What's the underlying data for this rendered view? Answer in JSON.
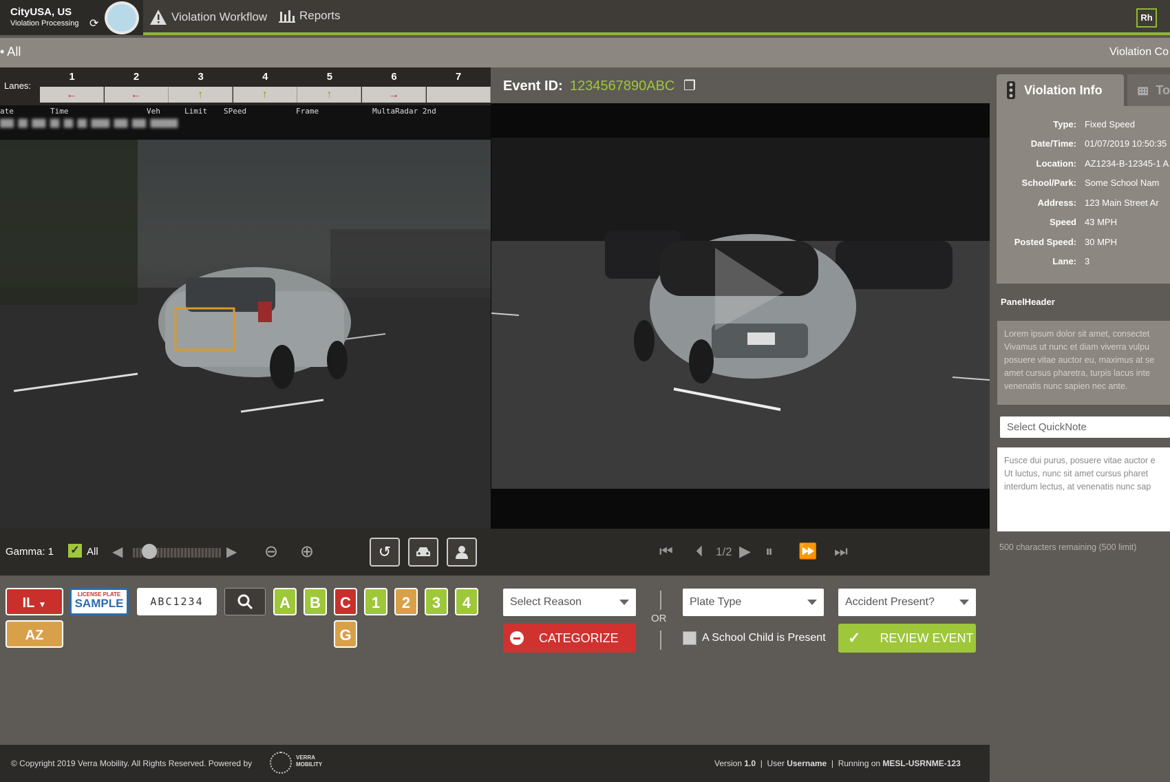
{
  "app": {
    "city": "CityUSA, US",
    "subtitle": "Violation Processing"
  },
  "nav": {
    "workflow": "Violation Workflow",
    "reports": "Reports",
    "user_initials": "Rh"
  },
  "subbar": {
    "left": "• All",
    "right": "Violation Co"
  },
  "lanes": {
    "label": "Lanes:",
    "items": [
      {
        "num": "1",
        "dir": "←",
        "color": "#cc2a2a"
      },
      {
        "num": "2",
        "dir": "←",
        "color": "#cc2a2a"
      },
      {
        "num": "3",
        "dir": "↑",
        "color": "#7aa51f"
      },
      {
        "num": "4",
        "dir": "↑",
        "color": "#7aa51f"
      },
      {
        "num": "5",
        "dir": "↑",
        "color": "#7aa51f"
      },
      {
        "num": "6",
        "dir": "→",
        "color": "#cc2a2a"
      },
      {
        "num": "7",
        "dir": "",
        "color": "#cfcbc7"
      }
    ]
  },
  "overlay": {
    "headers": [
      "ate",
      "Time",
      "Veh",
      "Limit",
      "SPeed",
      "Frame",
      "MultaRadar 2nd"
    ]
  },
  "event": {
    "label": "Event ID:",
    "id": "1234567890ABC"
  },
  "controls": {
    "gamma": "Gamma: 1",
    "all_label": "All",
    "frame_counter": "1/2"
  },
  "plates": {
    "state1": "IL",
    "state2": "AZ",
    "sample_top": "LICENSE PLATE",
    "sample_bottom": "SAMPLE",
    "plate_text": "ABC1234",
    "tiles": [
      "A",
      "B",
      "C",
      "1",
      "2",
      "3",
      "4",
      "G"
    ]
  },
  "actions": {
    "select_reason": "Select Reason",
    "categorize": "CATEGORIZE",
    "or": "OR",
    "plate_type": "Plate Type",
    "school_child": "A School Child is Present",
    "accident": "Accident Present?",
    "review": "REVIEW EVENT"
  },
  "violation": {
    "tab1": "Violation Info",
    "tab2": "To",
    "rows": [
      {
        "k": "Type:",
        "v": "Fixed Speed"
      },
      {
        "k": "Date/Time:",
        "v": "01/07/2019 10:50:35"
      },
      {
        "k": "Location:",
        "v": "AZ1234-B-12345-1 A"
      },
      {
        "k": "School/Park:",
        "v": "Some School Nam"
      },
      {
        "k": "Address:",
        "v": "123 Main Street Ar"
      },
      {
        "k": "Speed",
        "v": "43 MPH"
      },
      {
        "k": "Posted Speed:",
        "v": "30 MPH"
      },
      {
        "k": "Lane:",
        "v": "3"
      }
    ]
  },
  "notes": {
    "panel_header": "PanelHeader",
    "lorem": "Lorem ipsum dolor sit amet, consectet Vivamus ut nunc et diam viverra vulpu posuere vitae auctor eu, maximus at se amet cursus pharetra, turpis lacus inte venenatis nunc sapien nec ante.",
    "quicknote": "Select QuickNote",
    "textarea": "Fusce dui purus, posuere vitae auctor e Ut luctus, nunc sit amet cursus pharet interdum lectus, at venenatis nunc sap",
    "remaining": "500 characters remaining (500 limit)"
  },
  "footer": {
    "copyright": "© Copyright 2019 Verra Mobility. All Rights Reserved. Powered by",
    "logo_top": "VERRA",
    "logo_bottom": "MOBILITY",
    "version_label": "Version",
    "version": "1.0",
    "user_label": "User",
    "user": "Username",
    "running_label": "Running on",
    "machine": "MESL-USRNME-123"
  }
}
